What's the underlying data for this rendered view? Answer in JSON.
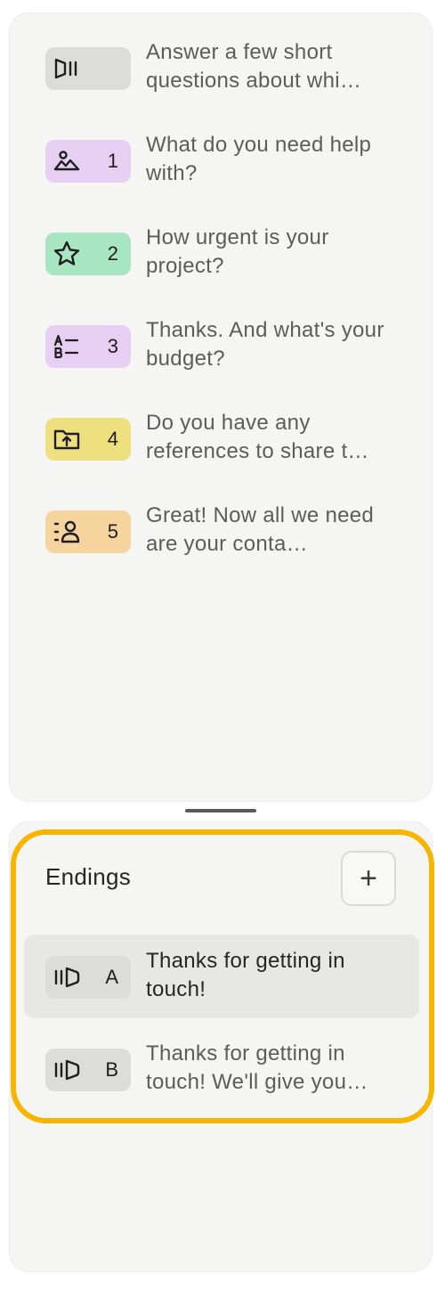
{
  "questions": [
    {
      "number": "",
      "text": "Answer a few short questions about whi…",
      "icon": "welcome-screen-icon",
      "color": "#dcdcda"
    },
    {
      "number": "1",
      "text": "What do you need help with?",
      "icon": "picture-choice-icon",
      "color": "#e6cff3"
    },
    {
      "number": "2",
      "text": "How urgent is your project?",
      "icon": "star-icon",
      "color": "#a8e6c1"
    },
    {
      "number": "3",
      "text": "Thanks. And what's your budget?",
      "icon": "multiple-choice-icon",
      "color": "#e6cff3"
    },
    {
      "number": "4",
      "text": "Do you have any references to share t…",
      "icon": "file-upload-icon",
      "color": "#efe07f"
    },
    {
      "number": "5",
      "text": "Great! Now all we need are your conta…",
      "icon": "contact-info-icon",
      "color": "#f6d49e"
    }
  ],
  "endings": {
    "title": "Endings",
    "add_label": "+",
    "items": [
      {
        "letter": "A",
        "text": "Thanks for getting in touch!",
        "icon": "ending-screen-icon",
        "color": "#dcdcda",
        "selected": true
      },
      {
        "letter": "B",
        "text": "Thanks for getting in touch! We'll give you…",
        "icon": "ending-screen-icon",
        "color": "#dcdcda",
        "selected": false
      }
    ]
  },
  "highlight_color": "#f7b500"
}
